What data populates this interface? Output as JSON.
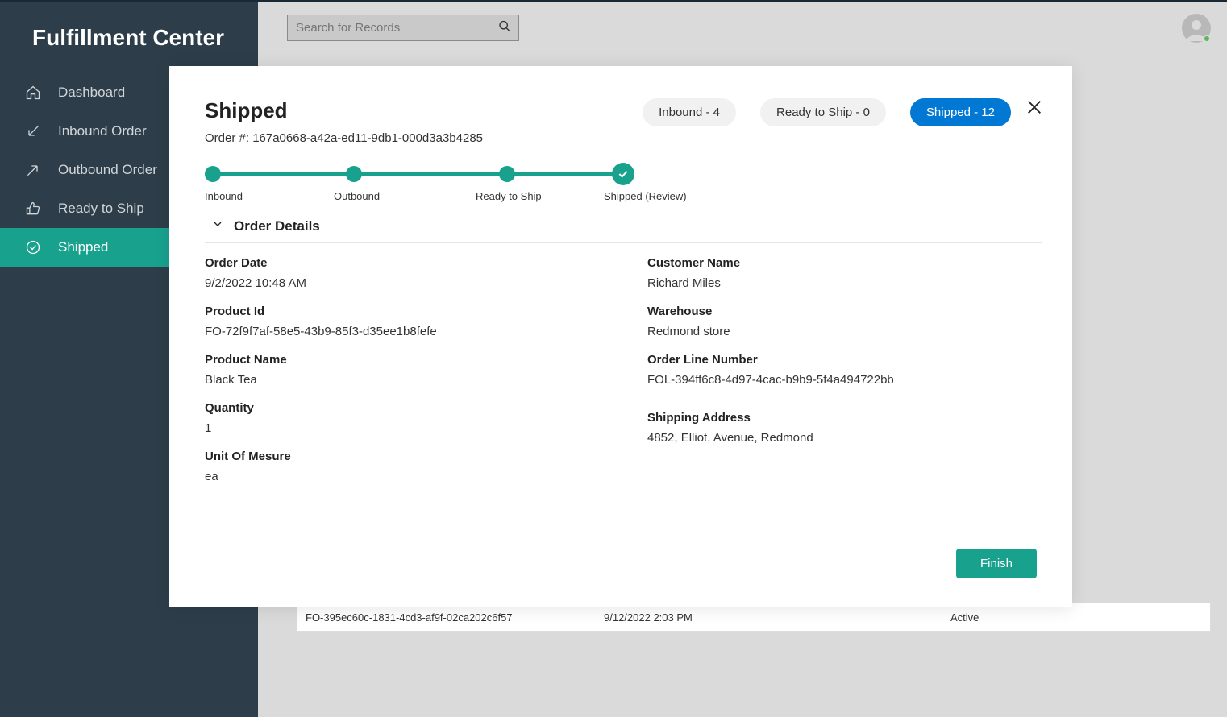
{
  "app": {
    "title": "Fulfillment Center",
    "search_placeholder": "Search for Records"
  },
  "sidebar": {
    "items": [
      {
        "label": "Dashboard",
        "icon": "home-icon"
      },
      {
        "label": "Inbound Order",
        "icon": "arrow-in-icon"
      },
      {
        "label": "Outbound Order",
        "icon": "arrow-out-icon"
      },
      {
        "label": "Ready to Ship",
        "icon": "thumbs-up-icon"
      },
      {
        "label": "Shipped",
        "icon": "check-circle-icon"
      }
    ]
  },
  "background_row": {
    "id": "FO-395ec60c-1831-4cd3-af9f-02ca202c6f57",
    "date": "9/12/2022 2:03 PM",
    "status": "Active"
  },
  "modal": {
    "title": "Shipped",
    "order_number_label": "Order #: ",
    "order_number": "167a0668-a42a-ed11-9db1-000d3a3b4285",
    "pills": [
      {
        "label": "Inbound - 4"
      },
      {
        "label": "Ready to Ship - 0"
      },
      {
        "label": "Shipped - 12"
      }
    ],
    "stepper": [
      "Inbound",
      "Outbound",
      "Ready to Ship",
      "Shipped (Review)"
    ],
    "section_title": "Order Details",
    "fields_left": [
      {
        "label": "Order Date",
        "value": "9/2/2022 10:48 AM"
      },
      {
        "label": "Product Id",
        "value": "FO-72f9f7af-58e5-43b9-85f3-d35ee1b8fefe"
      },
      {
        "label": "Product Name",
        "value": "Black Tea"
      },
      {
        "label": "Quantity",
        "value": "1"
      },
      {
        "label": "Unit Of Mesure",
        "value": "ea"
      }
    ],
    "fields_right": [
      {
        "label": "Customer Name",
        "value": "Richard Miles"
      },
      {
        "label": "Warehouse",
        "value": "Redmond store"
      },
      {
        "label": "Order Line Number",
        "value": "FOL-394ff6c8-4d97-4cac-b9b9-5f4a494722bb"
      },
      {
        "label": "Shipping Address",
        "value": "4852, Elliot, Avenue, Redmond"
      }
    ],
    "finish_label": "Finish"
  }
}
